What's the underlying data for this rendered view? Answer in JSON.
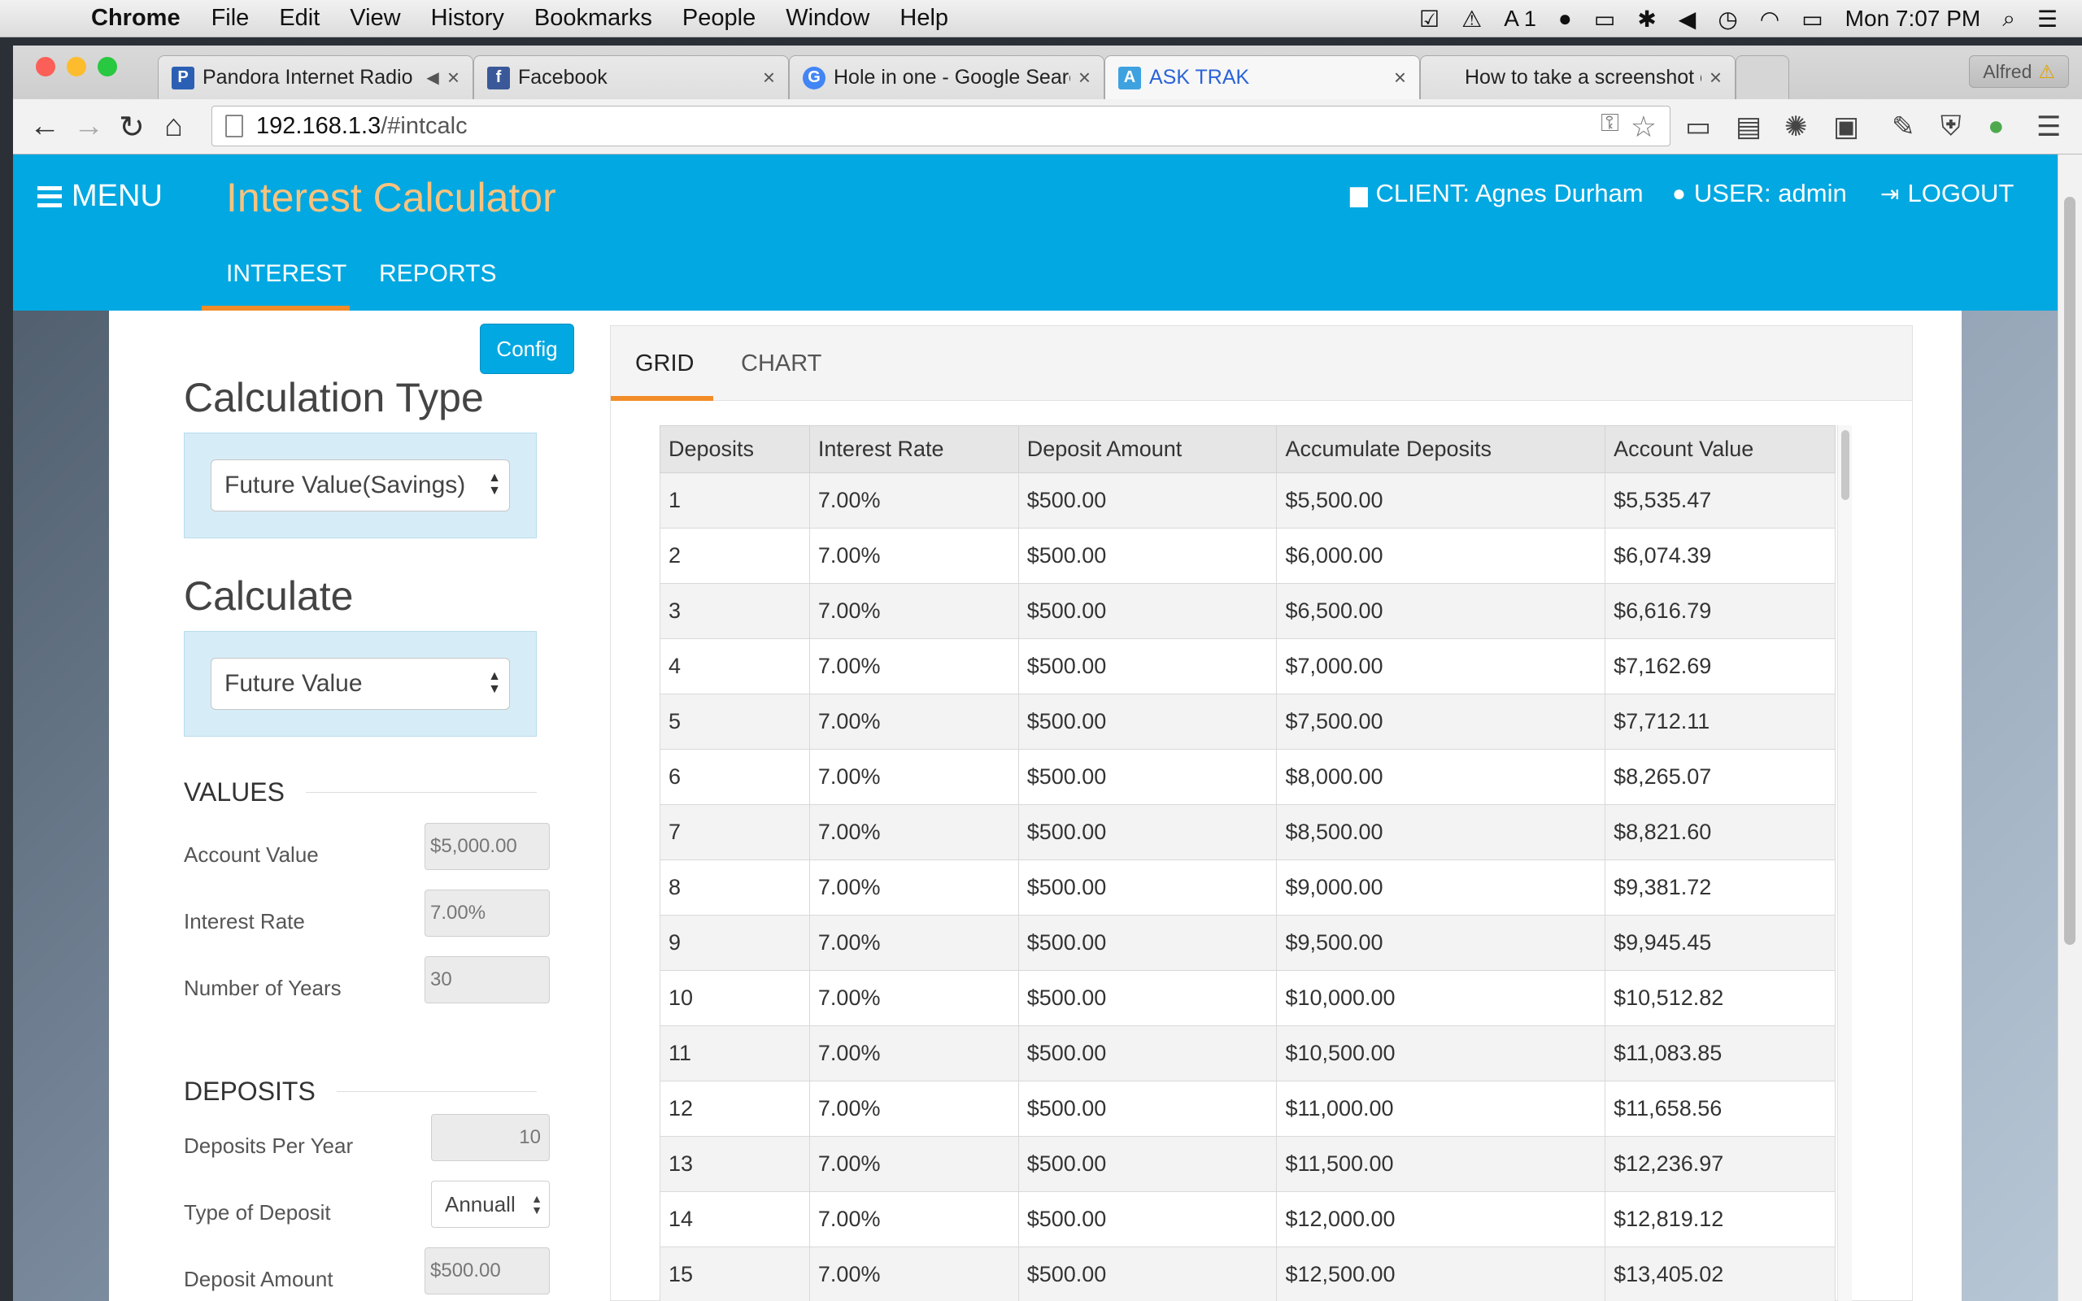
{
  "menubar": {
    "apple": "",
    "app_name": "Chrome",
    "items": [
      "File",
      "Edit",
      "View",
      "History",
      "Bookmarks",
      "People",
      "Window",
      "Help"
    ],
    "status_text": "1",
    "clock": "Mon 7:07 PM"
  },
  "browser": {
    "tabs": [
      {
        "label": "Pandora Internet Radio",
        "favicon": "P",
        "color": "#2b5fb4"
      },
      {
        "label": "Facebook",
        "favicon": "f",
        "color": "#3b5998"
      },
      {
        "label": "Hole in one - Google Search",
        "favicon": "G",
        "color": "#4285f4"
      },
      {
        "label": "ASK TRAK",
        "favicon": "A",
        "color": "#3fa2e0"
      },
      {
        "label": "How to take a screenshot on a Mac",
        "favicon": "",
        "color": "#888888"
      }
    ],
    "alfred": "Alfred",
    "url_host": "192.168.1.3",
    "url_path": "/#intcalc"
  },
  "app": {
    "menu_label": "MENU",
    "title": "Interest Calculator",
    "client": "CLIENT: Agnes Durham",
    "user": "USER: admin",
    "logout": "LOGOUT",
    "nav": {
      "interest": "INTEREST",
      "reports": "REPORTS"
    },
    "colors": {
      "brand": "#02a8e1",
      "accent": "#f28c28",
      "title": "#f8c37e"
    }
  },
  "left": {
    "config": "Config",
    "calc_type_heading": "Calculation Type",
    "calc_type_value": "Future Value(Savings)",
    "calculate_heading": "Calculate",
    "calculate_value": "Future Value",
    "values_heading": "VALUES",
    "account_value_label": "Account Value",
    "account_value": "$5,000.00",
    "interest_rate_label": "Interest Rate",
    "interest_rate": "7.00%",
    "years_label": "Number of Years",
    "years": "30",
    "deposits_heading": "DEPOSITS",
    "deposits_per_year_label": "Deposits Per Year",
    "deposits_per_year": "10",
    "deposit_type_label": "Type of Deposit",
    "deposit_type": "Annuall",
    "deposit_amount_label": "Deposit Amount",
    "deposit_amount": "$500.00"
  },
  "grid": {
    "tabs": {
      "grid": "GRID",
      "chart": "CHART"
    },
    "columns": [
      "Deposits",
      "Interest Rate",
      "Deposit Amount",
      "Accumulate Deposits",
      "Account Value"
    ],
    "rows": [
      [
        "1",
        "7.00%",
        "$500.00",
        "$5,500.00",
        "$5,535.47"
      ],
      [
        "2",
        "7.00%",
        "$500.00",
        "$6,000.00",
        "$6,074.39"
      ],
      [
        "3",
        "7.00%",
        "$500.00",
        "$6,500.00",
        "$6,616.79"
      ],
      [
        "4",
        "7.00%",
        "$500.00",
        "$7,000.00",
        "$7,162.69"
      ],
      [
        "5",
        "7.00%",
        "$500.00",
        "$7,500.00",
        "$7,712.11"
      ],
      [
        "6",
        "7.00%",
        "$500.00",
        "$8,000.00",
        "$8,265.07"
      ],
      [
        "7",
        "7.00%",
        "$500.00",
        "$8,500.00",
        "$8,821.60"
      ],
      [
        "8",
        "7.00%",
        "$500.00",
        "$9,000.00",
        "$9,381.72"
      ],
      [
        "9",
        "7.00%",
        "$500.00",
        "$9,500.00",
        "$9,945.45"
      ],
      [
        "10",
        "7.00%",
        "$500.00",
        "$10,000.00",
        "$10,512.82"
      ],
      [
        "11",
        "7.00%",
        "$500.00",
        "$10,500.00",
        "$11,083.85"
      ],
      [
        "12",
        "7.00%",
        "$500.00",
        "$11,000.00",
        "$11,658.56"
      ],
      [
        "13",
        "7.00%",
        "$500.00",
        "$11,500.00",
        "$12,236.97"
      ],
      [
        "14",
        "7.00%",
        "$500.00",
        "$12,000.00",
        "$12,819.12"
      ],
      [
        "15",
        "7.00%",
        "$500.00",
        "$12,500.00",
        "$13,405.02"
      ]
    ]
  }
}
